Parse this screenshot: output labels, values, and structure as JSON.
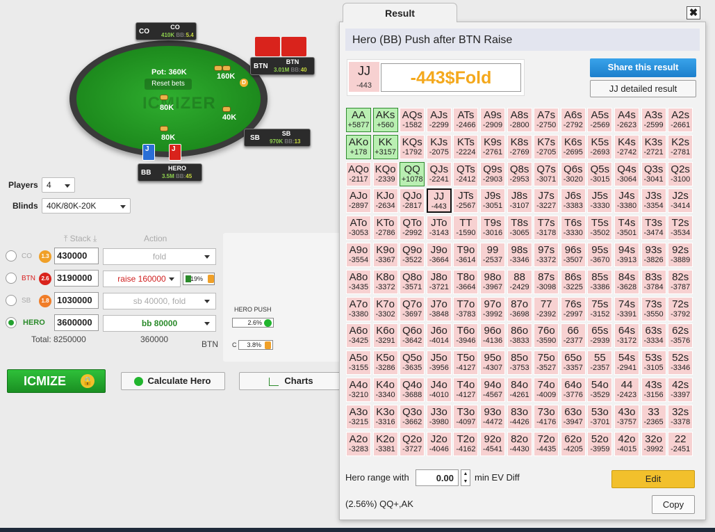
{
  "table": {
    "pot_label": "Pot: 360K",
    "reset_label": "Reset bets",
    "watermark": "ICMIZER",
    "bets": {
      "co": "160K",
      "sb": "40K",
      "btn": "80K",
      "hero": "80K"
    },
    "dealer": "D",
    "seats": {
      "co": {
        "pos": "CO",
        "name": "CO",
        "stack": "410K",
        "bb_label": "BB:",
        "bb": "5.4"
      },
      "btn": {
        "pos": "BTN",
        "name": "BTN",
        "stack": "3.01M",
        "bb_label": "BB:",
        "bb": "40"
      },
      "sb": {
        "pos": "SB",
        "name": "SB",
        "stack": "970K",
        "bb_label": "BB:",
        "bb": "13"
      },
      "hero": {
        "pos": "BB",
        "name": "HERO",
        "stack": "3.5M",
        "bb_label": "BB:",
        "bb": "45"
      }
    },
    "hero_cards": [
      "J",
      "J"
    ]
  },
  "form": {
    "players_label": "Players",
    "players_value": "4",
    "blinds_label": "Blinds",
    "blinds_value": "40K/80K-20K",
    "stack_header": "Stack",
    "action_header": "Action",
    "rows": [
      {
        "label": "CO",
        "badge": "1.3",
        "stack": "430000",
        "action": "fold"
      },
      {
        "label": "BTN",
        "badge": "2.6",
        "stack": "3190000",
        "action": "raise 160000",
        "pct": "19%"
      },
      {
        "label": "SB",
        "badge": "1.8",
        "stack": "1030000",
        "action": "sb 40000, fold"
      },
      {
        "label": "HERO",
        "badge": "",
        "stack": "3600000",
        "action": "bb 80000"
      }
    ],
    "total_label": "Total:",
    "total_value": "8250000",
    "hero_stack_total": "360000",
    "btn_label": "BTN"
  },
  "toolbar": {
    "icmize": "ICMIZE",
    "calculate": "Calculate Hero",
    "charts": "Charts"
  },
  "mini": {
    "hero_push_label": "HERO PUSH",
    "hero_push_pct": "2.6%",
    "call_label": "C",
    "call_pct": "3.8%"
  },
  "dialog": {
    "tab": "Result",
    "close": "✖",
    "title": "Hero (BB) Push after BTN Raise",
    "hand": "JJ",
    "hand_ev": "-443",
    "result": "-443$Fold",
    "share": "Share this result",
    "detailed": "JJ detailed result",
    "range_label": "Hero range with",
    "range_value": "0.00",
    "min_ev_label": "min EV Diff",
    "edit": "Edit",
    "summary": "(2.56%) QQ+,AK",
    "copy": "Copy"
  },
  "matrix": {
    "hands": [
      [
        "AA",
        "AKs",
        "AQs",
        "AJs",
        "ATs",
        "A9s",
        "A8s",
        "A7s",
        "A6s",
        "A5s",
        "A4s",
        "A3s",
        "A2s"
      ],
      [
        "AKo",
        "KK",
        "KQs",
        "KJs",
        "KTs",
        "K9s",
        "K8s",
        "K7s",
        "K6s",
        "K5s",
        "K4s",
        "K3s",
        "K2s"
      ],
      [
        "AQo",
        "KQo",
        "QQ",
        "QJs",
        "QTs",
        "Q9s",
        "Q8s",
        "Q7s",
        "Q6s",
        "Q5s",
        "Q4s",
        "Q3s",
        "Q2s"
      ],
      [
        "AJo",
        "KJo",
        "QJo",
        "JJ",
        "JTs",
        "J9s",
        "J8s",
        "J7s",
        "J6s",
        "J5s",
        "J4s",
        "J3s",
        "J2s"
      ],
      [
        "ATo",
        "KTo",
        "QTo",
        "JTo",
        "TT",
        "T9s",
        "T8s",
        "T7s",
        "T6s",
        "T5s",
        "T4s",
        "T3s",
        "T2s"
      ],
      [
        "A9o",
        "K9o",
        "Q9o",
        "J9o",
        "T9o",
        "99",
        "98s",
        "97s",
        "96s",
        "95s",
        "94s",
        "93s",
        "92s"
      ],
      [
        "A8o",
        "K8o",
        "Q8o",
        "J8o",
        "T8o",
        "98o",
        "88",
        "87s",
        "86s",
        "85s",
        "84s",
        "83s",
        "82s"
      ],
      [
        "A7o",
        "K7o",
        "Q7o",
        "J7o",
        "T7o",
        "97o",
        "87o",
        "77",
        "76s",
        "75s",
        "74s",
        "73s",
        "72s"
      ],
      [
        "A6o",
        "K6o",
        "Q6o",
        "J6o",
        "T6o",
        "96o",
        "86o",
        "76o",
        "66",
        "65s",
        "64s",
        "63s",
        "62s"
      ],
      [
        "A5o",
        "K5o",
        "Q5o",
        "J5o",
        "T5o",
        "95o",
        "85o",
        "75o",
        "65o",
        "55",
        "54s",
        "53s",
        "52s"
      ],
      [
        "A4o",
        "K4o",
        "Q4o",
        "J4o",
        "T4o",
        "94o",
        "84o",
        "74o",
        "64o",
        "54o",
        "44",
        "43s",
        "42s"
      ],
      [
        "A3o",
        "K3o",
        "Q3o",
        "J3o",
        "T3o",
        "93o",
        "83o",
        "73o",
        "63o",
        "53o",
        "43o",
        "33",
        "32s"
      ],
      [
        "A2o",
        "K2o",
        "Q2o",
        "J2o",
        "T2o",
        "92o",
        "82o",
        "72o",
        "62o",
        "52o",
        "42o",
        "32o",
        "22"
      ]
    ],
    "evs": [
      [
        "+5877",
        "+560",
        "-1582",
        "-2299",
        "-2466",
        "-2909",
        "-2800",
        "-2750",
        "-2792",
        "-2569",
        "-2623",
        "-2599",
        "-2661"
      ],
      [
        "+178",
        "+3157",
        "-1792",
        "-2075",
        "-2224",
        "-2761",
        "-2769",
        "-2705",
        "-2695",
        "-2693",
        "-2742",
        "-2721",
        "-2781"
      ],
      [
        "-2117",
        "-2339",
        "+1078",
        "-2241",
        "-2412",
        "-2903",
        "-2953",
        "-3071",
        "-3020",
        "-3015",
        "-3064",
        "-3041",
        "-3100"
      ],
      [
        "-2897",
        "-2634",
        "-2817",
        "-443",
        "-2567",
        "-3051",
        "-3107",
        "-3227",
        "-3383",
        "-3330",
        "-3380",
        "-3354",
        "-3414"
      ],
      [
        "-3053",
        "-2786",
        "-2992",
        "-3143",
        "-1590",
        "-3016",
        "-3065",
        "-3178",
        "-3330",
        "-3502",
        "-3501",
        "-3474",
        "-3534"
      ],
      [
        "-3554",
        "-3367",
        "-3522",
        "-3664",
        "-3614",
        "-2537",
        "-3346",
        "-3372",
        "-3507",
        "-3670",
        "-3913",
        "-3826",
        "-3889"
      ],
      [
        "-3435",
        "-3372",
        "-3571",
        "-3721",
        "-3664",
        "-3967",
        "-2429",
        "-3098",
        "-3225",
        "-3386",
        "-3628",
        "-3784",
        "-3787"
      ],
      [
        "-3380",
        "-3302",
        "-3697",
        "-3848",
        "-3783",
        "-3992",
        "-3698",
        "-2392",
        "-2997",
        "-3152",
        "-3391",
        "-3550",
        "-3792"
      ],
      [
        "-3425",
        "-3291",
        "-3642",
        "-4014",
        "-3946",
        "-4136",
        "-3833",
        "-3590",
        "-2377",
        "-2939",
        "-3172",
        "-3334",
        "-3576"
      ],
      [
        "-3155",
        "-3286",
        "-3635",
        "-3956",
        "-4127",
        "-4307",
        "-3753",
        "-3527",
        "-3357",
        "-2357",
        "-2941",
        "-3105",
        "-3346"
      ],
      [
        "-3210",
        "-3340",
        "-3688",
        "-4010",
        "-4127",
        "-4567",
        "-4261",
        "-4009",
        "-3776",
        "-3529",
        "-2423",
        "-3156",
        "-3397"
      ],
      [
        "-3215",
        "-3316",
        "-3662",
        "-3980",
        "-4097",
        "-4472",
        "-4426",
        "-4176",
        "-3947",
        "-3701",
        "-3757",
        "-2365",
        "-3378"
      ],
      [
        "-3283",
        "-3381",
        "-3727",
        "-4046",
        "-4162",
        "-4541",
        "-4430",
        "-4435",
        "-4205",
        "-3959",
        "-4015",
        "-3992",
        "-2451"
      ]
    ],
    "push_hands": [
      "AA",
      "AKs",
      "AKo",
      "KK",
      "QQ"
    ],
    "selected_hand": "JJ"
  },
  "colors": {
    "push": "#b9efb2",
    "fold": "#f7d1d1",
    "accent_green": "#21b52e",
    "result_orange": "#f4a81c",
    "share_blue": "#1c7fcc",
    "edit_yellow": "#f2c02c"
  }
}
